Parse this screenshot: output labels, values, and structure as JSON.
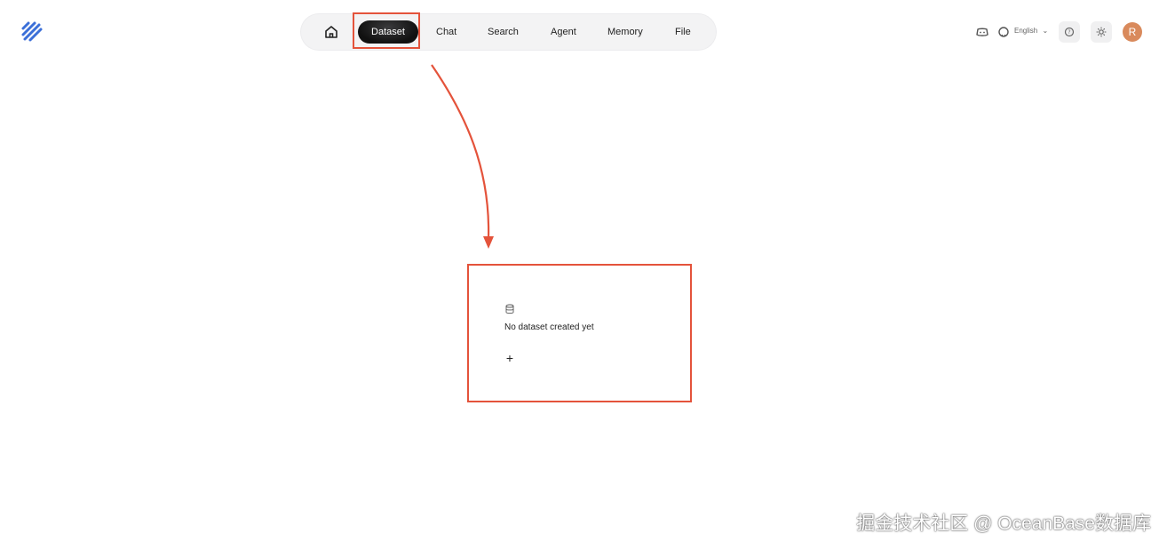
{
  "nav": {
    "home_icon": "home-icon",
    "items": [
      {
        "label": "Dataset",
        "active": true
      },
      {
        "label": "Chat"
      },
      {
        "label": "Search"
      },
      {
        "label": "Agent"
      },
      {
        "label": "Memory"
      },
      {
        "label": "File"
      }
    ]
  },
  "header_tools": {
    "discord_icon": "discord-icon",
    "github_icon": "github-icon",
    "language": "English",
    "help_icon": "help-icon",
    "theme_icon": "sun-icon",
    "avatar_initial": "R"
  },
  "empty_state": {
    "icon": "database-icon",
    "message": "No dataset created yet",
    "add_symbol": "+"
  },
  "watermark": "掘金技术社区 @ OceanBase数据库",
  "colors": {
    "highlight": "#e4533b",
    "nav_bg": "#f3f3f4",
    "active_tab": "#111111",
    "avatar": "#d98a5c",
    "logo": "#3b6fd8"
  }
}
